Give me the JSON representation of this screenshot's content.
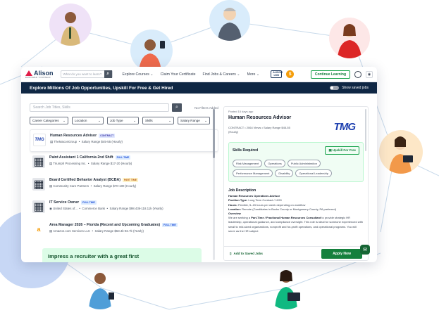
{
  "nav": {
    "brand": "Alison",
    "tagline": "EMPOWER YOURSELF",
    "search_placeholder": "What do you want to learn?",
    "menu": [
      "Explore Courses ⌄",
      "Claim Your Certificate",
      "Find Jobs & Careers ⌄",
      "More ⌄"
    ],
    "lms_label": "ALISON LMS",
    "continue_label": "Continue Learning"
  },
  "banner": {
    "title": "Explore Millions Of Job Opportunities, Upskill For Free & Get Hired",
    "toggle_label": "Show saved jobs"
  },
  "search": {
    "placeholder": "Search Job Titles, Skills",
    "no_filters": "No Filters Added"
  },
  "filters": [
    "Career Categories",
    "Location",
    "Job Type",
    "Skills",
    "Salary Range"
  ],
  "jobs": [
    {
      "title": "Human Resources Advisor",
      "badge": "CONTRACT",
      "company": "TheMaconGroup",
      "salary": "Salary Range $45-55 (Hourly)"
    },
    {
      "title": "Paint Assistant 1 California 2nd Shift",
      "badge": "FULL TIME",
      "company": "Triumph Processing Inc.",
      "salary": "Salary Range $17-20 (Hourly)"
    },
    {
      "title": "Board Certified Behavior Analyst (BCBA)",
      "badge": "PART TIME",
      "company": "Community Care Partners",
      "salary": "Salary Range $70-100 (Hourly)"
    },
    {
      "title": "IT Service Owner",
      "badge": "FULL TIME",
      "company": "United States of...",
      "company2": "Commerce Bank",
      "salary": "Salary Range $98.43k-118.11k (Yearly)"
    },
    {
      "title": "Area Manager 2026 – Florida (Recent and Upcoming Graduates)",
      "badge": "FULL TIME",
      "company": "Amazon.com Services LLC",
      "salary": "Salary Range $63.4k-92.7k (Yearly)"
    }
  ],
  "promo": {
    "text": "Impress a recruiter with a great first"
  },
  "detail": {
    "posted": "Posted 15 days ago",
    "title": "Human Resources Advisor",
    "meta_type": "CONTRACT",
    "meta_views": "2064 Views",
    "meta_salary": "Salary Range $45-55 (Hourly)",
    "company_logo": "TMG",
    "skills_header": "Skills Required",
    "upskill_label": "Upskill For Free",
    "skills": [
      "Risk Management",
      "Operations",
      "Public Administration",
      "Performance Management",
      "Disability",
      "Operational Leadership"
    ],
    "jd_header": "Job Description",
    "jd_title": "Human Resources Operations Advisor",
    "jd_position_label": "Position Type:",
    "jd_position": "Long Term Contract / 1099",
    "jd_hours_label": "Hours:",
    "jd_hours": "Flexible, 5–15 hours per week depending on workflow",
    "jd_location_label": "Location:",
    "jd_location": "Remote (Candidates in Bucks County or Montgomery County, PA preferred)",
    "jd_overview_label": "Overview",
    "jd_overview_1": "We are seeking a",
    "jd_overview_bold": "Part-Time / Fractional Human Resources Consultant",
    "jd_overview_2": "to provide strategic HR leadership, operational guidance, and compliance oversight. This role is ideal for someone experienced with small to mid-sized organizations, nonprofit and for-profit operations, and operational programs. You will serve as the HR subject",
    "save_label": "Add to Saved Jobs",
    "apply_label": "Apply Now"
  },
  "colors": {
    "navy": "#0f2744",
    "green": "#15803d",
    "brand_red": "#e11d48"
  }
}
